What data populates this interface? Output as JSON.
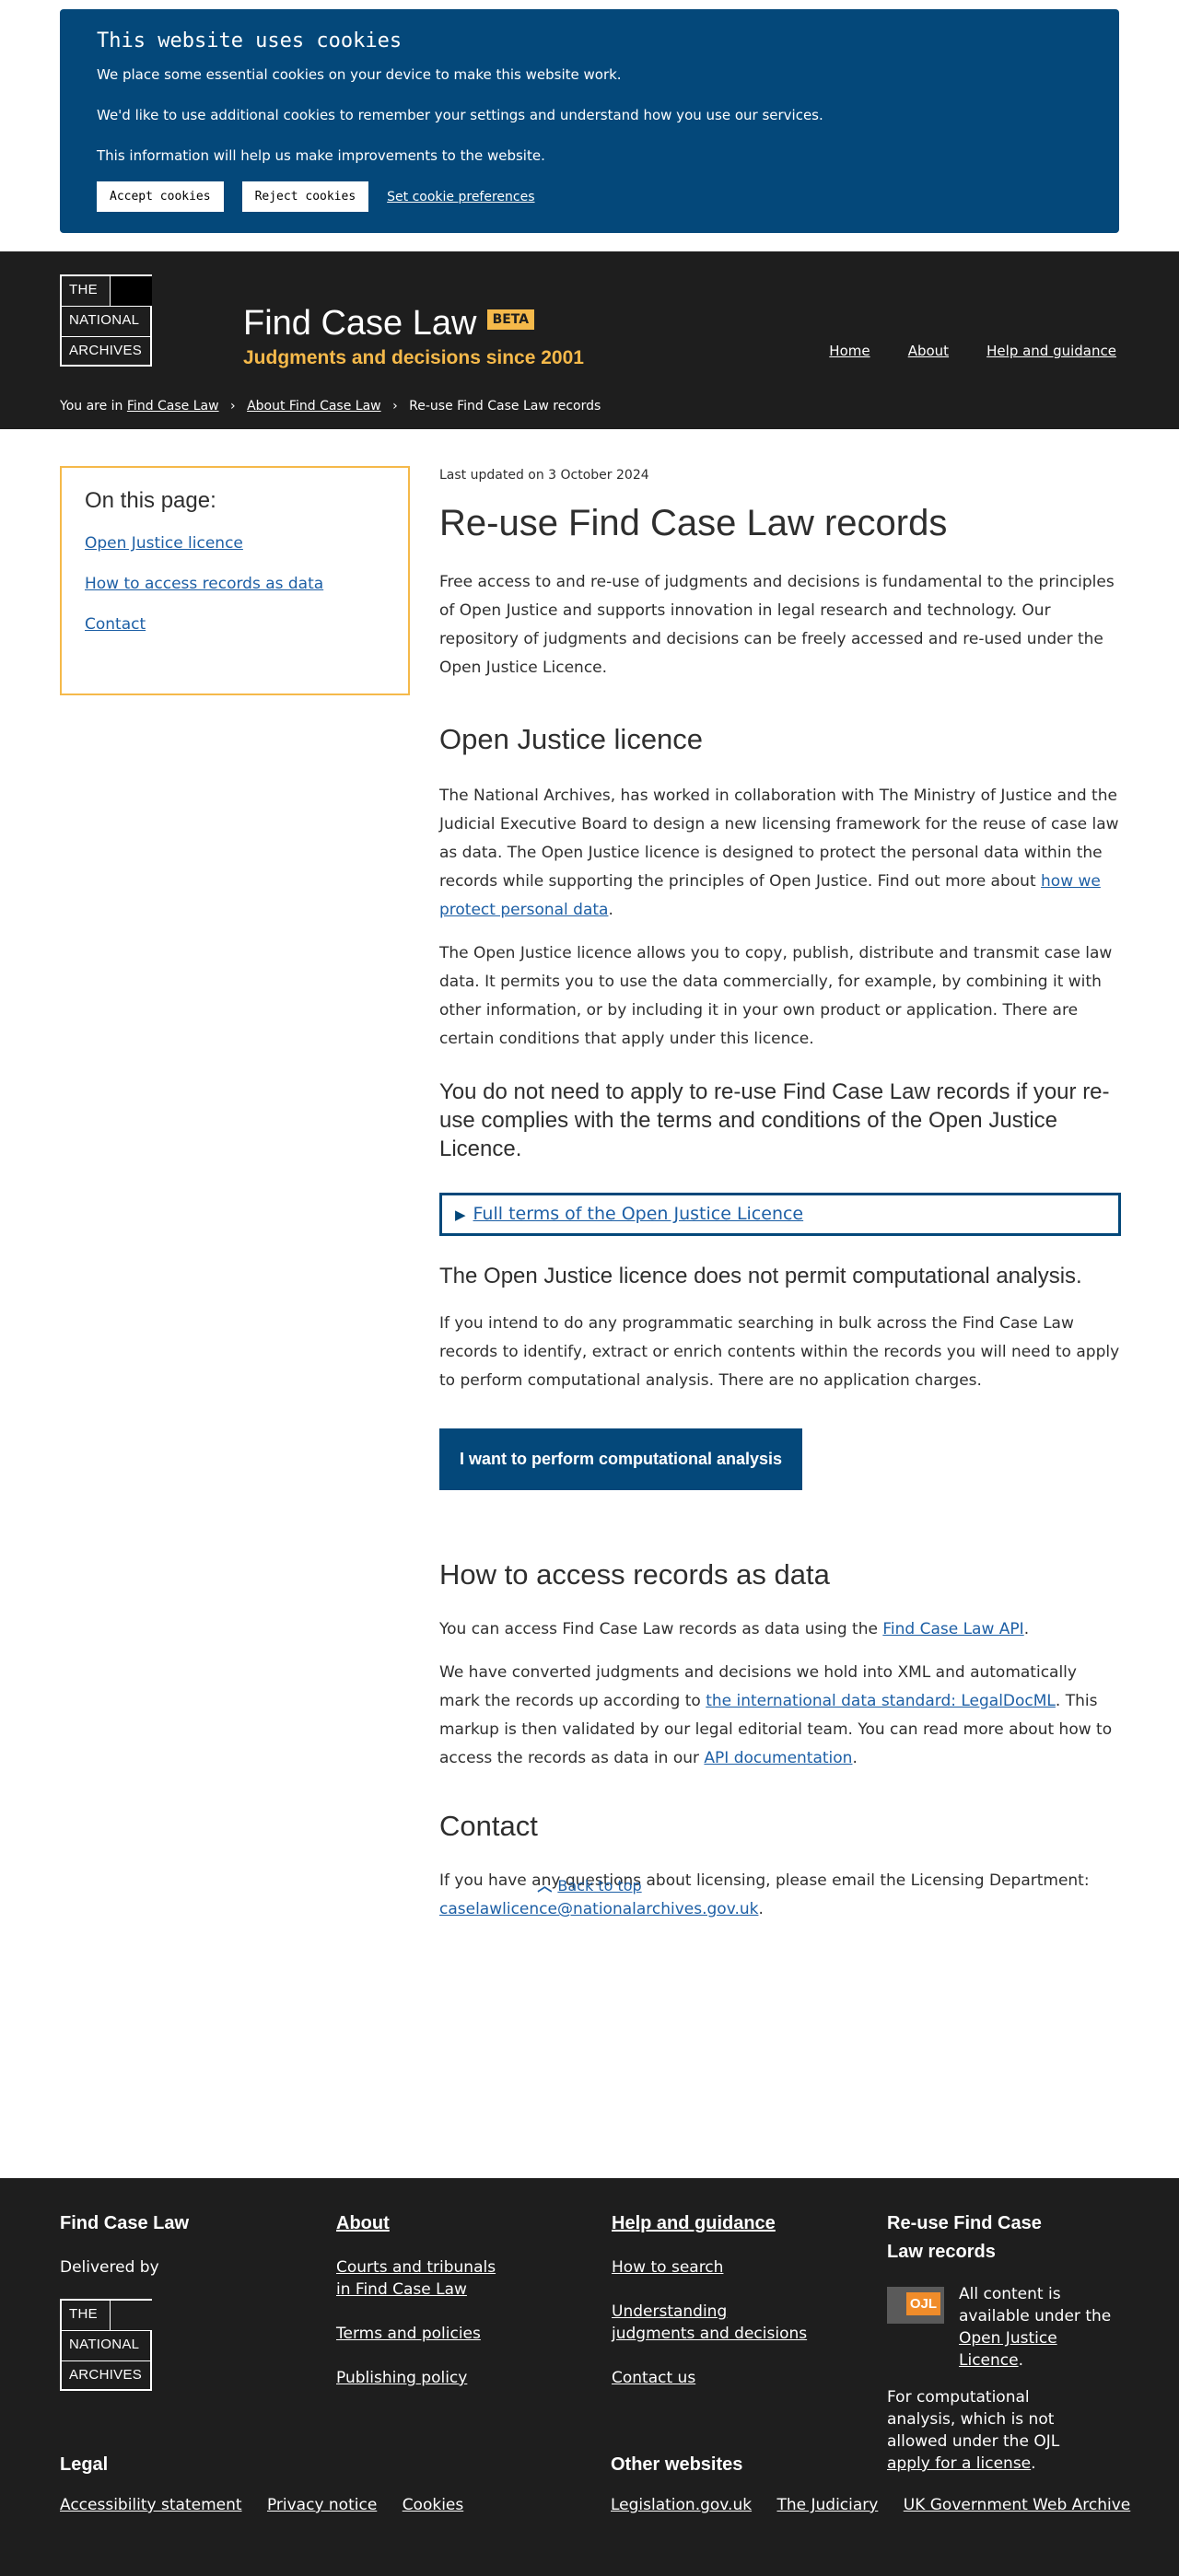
{
  "cookies": {
    "title": "This website uses cookies",
    "p1": "We place some essential cookies on your device to make this website work.",
    "p2": "We'd like to use additional cookies to remember your settings and understand how you use our services.",
    "p3": "This information will help us make improvements to the website.",
    "accept": "Accept cookies",
    "reject": "Reject cookies",
    "prefs": "Set cookie preferences"
  },
  "header": {
    "logo": [
      "The",
      "National",
      "Archives"
    ],
    "site_name": "Find Case Law",
    "beta": "BETA",
    "tagline": "Judgments and decisions since 2001",
    "nav": [
      "Home",
      "About",
      "Help and guidance"
    ],
    "breadcrumb": {
      "prefix": "You are in",
      "items": [
        "Find Case Law",
        "About Find Case Law"
      ],
      "current": "Re-use Find Case Law records"
    }
  },
  "toc": {
    "title": "On this page:",
    "items": [
      "Open Justice licence",
      "How to access records as data",
      "Contact"
    ]
  },
  "content": {
    "updated": "Last updated on 3 October 2024",
    "title": "Re-use Find Case Law records",
    "intro": "Free access to and re-use of judgments and decisions is fundamental to the principles of Open Justice and supports innovation in legal research and technology. Our repository of judgments and decisions can be freely accessed and re-used under the Open Justice Licence.",
    "licence_heading": "Open Justice licence",
    "licence_p1": "The National Archives, has worked in collaboration with The Ministry of Justice and the Judicial Executive Board to design a new licensing framework for the reuse of case law as data. The Open Justice licence is designed to protect the personal data within the records while supporting the principles of Open Justice. Find out more about ",
    "licence_p1_link": "how we protect personal data",
    "licence_p1_end": ".",
    "licence_p2": "The Open Justice licence allows you to copy, publish, distribute and transmit case law data. It permits you to use the data commercially, for example, by combining it with other information, or by including it in your own product or application. There are certain conditions that apply under this licence.",
    "no_apply": "You do not need to apply to re-use Find Case Law records if your re-use complies with the terms and conditions of the Open Justice Licence.",
    "full_terms": "Full terms of the Open Justice Licence",
    "not_permit": "The Open Justice licence does not permit computational analysis.",
    "bulk_p": "If you intend to do any programmatic searching in bulk across the Find Case Law records to identify, extract or enrich contents within the records you will need to apply to perform computational analysis. There are no application charges.",
    "cta": "I want to perform computational analysis",
    "access_heading": "How to access records as data",
    "access_p1": "You can access Find Case Law records as data using the ",
    "access_p1_link": "Find Case Law API",
    "access_p1_end": ".",
    "access_p2a": "We have converted judgments and decisions we hold into XML and automatically mark the records up according to ",
    "access_p2_link1": "the international data standard: LegalDocML",
    "access_p2b": ". This markup is then validated by our legal editorial team. You can read more about how to access the records as data in our ",
    "access_p2_link2": "API documentation",
    "access_p2_end": ".",
    "contact_heading": "Contact",
    "contact_p": "If you have any questions about licensing, please email the Licensing Department: ",
    "contact_email": "caselawlicence@nationalarchives.gov.uk",
    "contact_end": "."
  },
  "back_to_top": "Back to top",
  "footer": {
    "col1_title": "Find Case Law",
    "delivered_by": "Delivered by",
    "col2_title": "About",
    "col2_links": [
      "Courts and tribunals in Find Case Law",
      "Terms and policies",
      "Publishing policy"
    ],
    "col3_title": "Help and guidance",
    "col3_links": [
      "How to search",
      "Understanding judgments and decisions",
      "Contact us"
    ],
    "col4_title": "Re-use Find Case Law records",
    "ojl_badge": "OJL",
    "ojl_text": "All content is available under the ",
    "ojl_link": "Open Justice Licence",
    "ojl_end": ".",
    "comp_text": "For computational analysis, which is not allowed under the OJL ",
    "comp_link": "apply for a license",
    "comp_end": ".",
    "legal_title": "Legal",
    "legal_links": [
      "Accessibility statement",
      "Privacy notice",
      "Cookies"
    ],
    "other_title": "Other websites",
    "other_links": [
      "Legislation.gov.uk",
      "The Judiciary",
      "UK Government Web Archive"
    ]
  }
}
